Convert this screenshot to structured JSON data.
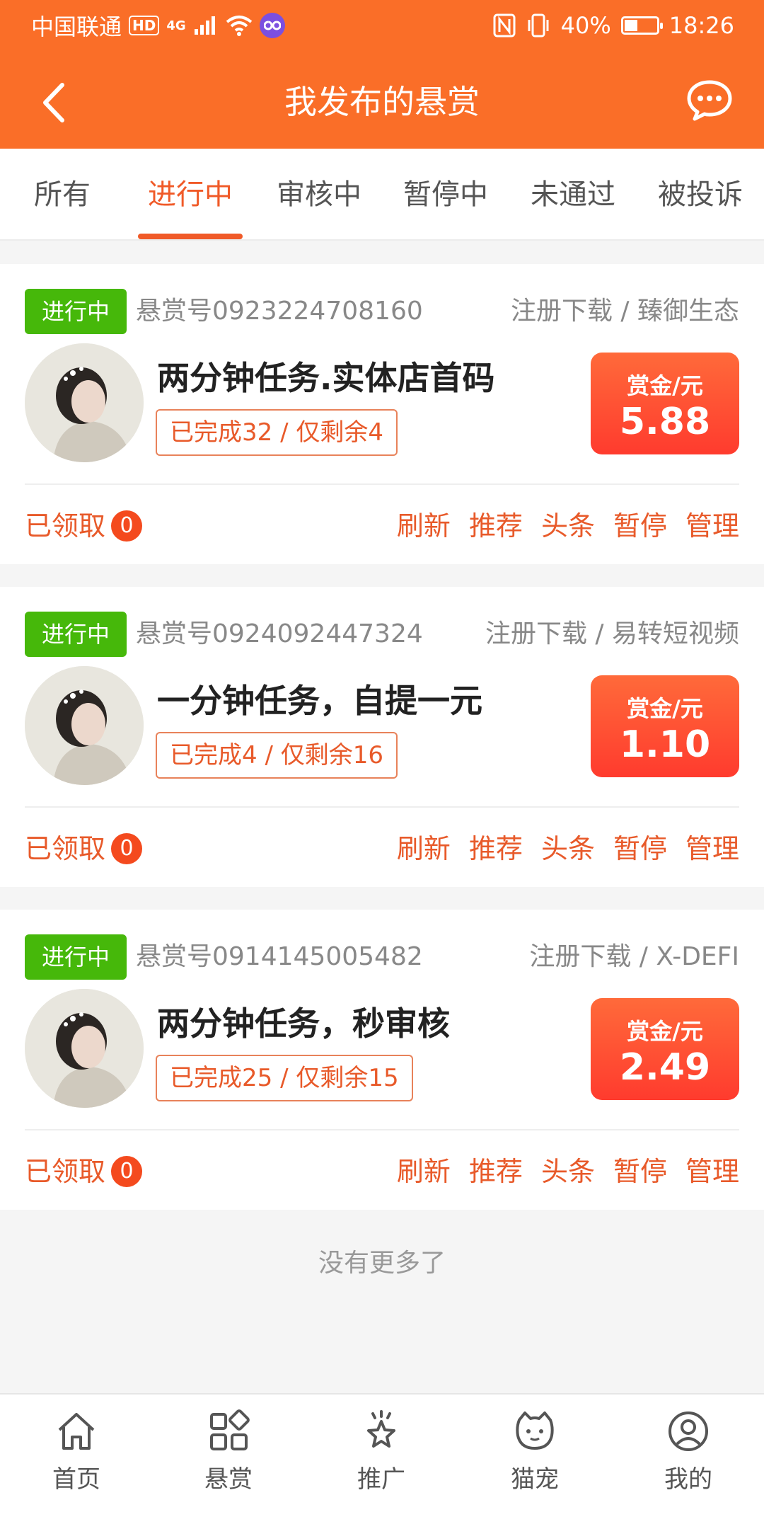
{
  "status_bar": {
    "carrier": "中国联通",
    "hd": "HD",
    "network": "4G",
    "battery": "40%",
    "time": "18:26"
  },
  "header": {
    "title": "我发布的悬赏",
    "back_icon": "chevron-left-icon",
    "message_icon": "chat-bubble-icon"
  },
  "tabs": [
    {
      "label": "所有"
    },
    {
      "label": "进行中",
      "active": true
    },
    {
      "label": "审核中"
    },
    {
      "label": "暂停中"
    },
    {
      "label": "未通过"
    },
    {
      "label": "被投诉"
    }
  ],
  "cards": [
    {
      "status": "进行中",
      "bounty_no": "悬赏号0923224708160",
      "category": "注册下载 / 臻御生态",
      "title": "两分钟任务.实体店首码",
      "progress": "已完成32 / 仅剩余4",
      "reward_label": "赏金/元",
      "reward_value": "5.88",
      "claimed_label": "已领取",
      "claimed_count": "0"
    },
    {
      "status": "进行中",
      "bounty_no": "悬赏号0924092447324",
      "category": "注册下载 / 易转短视频",
      "title": "一分钟任务，自提一元",
      "progress": "已完成4 / 仅剩余16",
      "reward_label": "赏金/元",
      "reward_value": "1.10",
      "claimed_label": "已领取",
      "claimed_count": "0"
    },
    {
      "status": "进行中",
      "bounty_no": "悬赏号0914145005482",
      "category": "注册下载 / X-DEFI",
      "title": "两分钟任务，秒审核",
      "progress": "已完成25 / 仅剩余15",
      "reward_label": "赏金/元",
      "reward_value": "2.49",
      "claimed_label": "已领取",
      "claimed_count": "0"
    }
  ],
  "card_actions": [
    "刷新",
    "推荐",
    "头条",
    "暂停",
    "管理"
  ],
  "footer_text": "没有更多了",
  "bottom_nav": [
    {
      "label": "首页",
      "icon": "home-icon"
    },
    {
      "label": "悬赏",
      "icon": "apps-icon"
    },
    {
      "label": "推广",
      "icon": "star-promo-icon"
    },
    {
      "label": "猫宠",
      "icon": "cat-icon"
    },
    {
      "label": "我的",
      "icon": "user-icon"
    }
  ],
  "colors": {
    "brand": "#fa6e28",
    "accent": "#f05a28",
    "status_green": "#46b80a"
  }
}
